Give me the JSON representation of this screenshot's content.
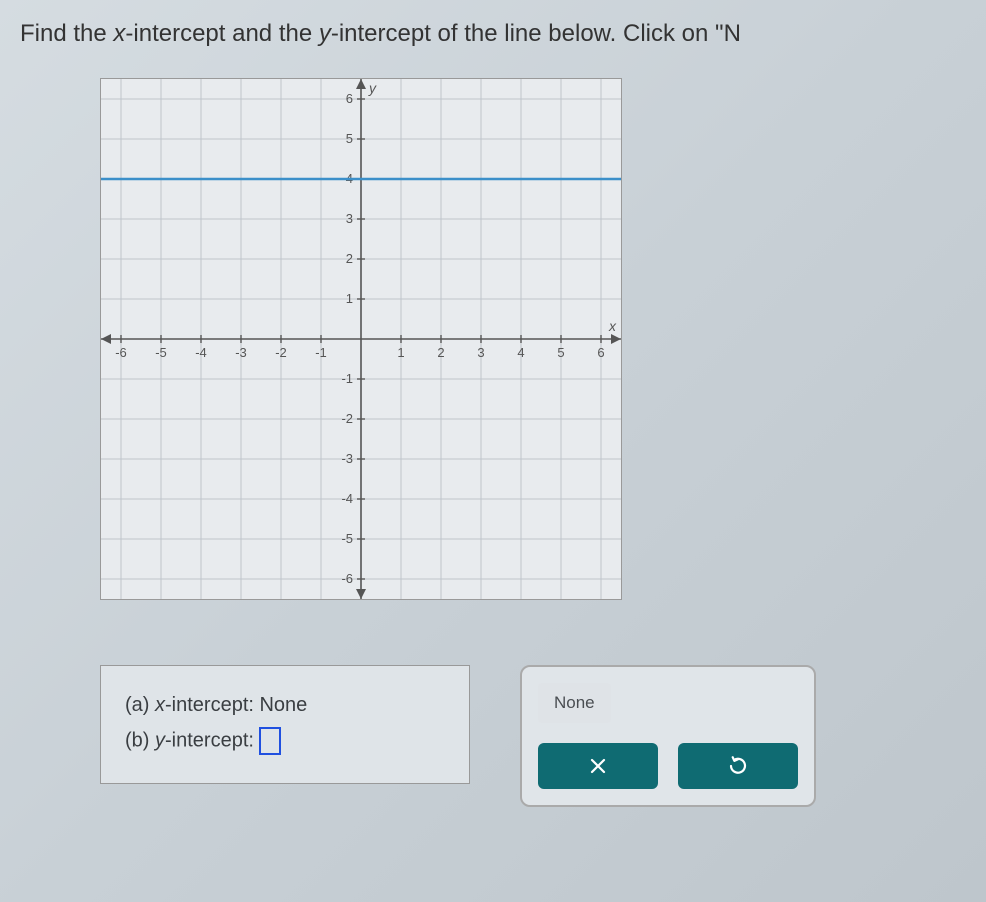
{
  "question": {
    "prefix": "Find the ",
    "x_var": "x",
    "mid1": "-intercept and the ",
    "y_var": "y",
    "mid2": "-intercept of the line below. Click on \"N"
  },
  "answers": {
    "a_prefix": "(a) ",
    "a_var": "x",
    "a_text": "-intercept: ",
    "a_value": "None",
    "b_prefix": "(b) ",
    "b_var": "y",
    "b_text": "-intercept: "
  },
  "tools": {
    "none_label": "None"
  },
  "chart_data": {
    "type": "line",
    "title": "",
    "xlabel": "x",
    "ylabel": "y",
    "xlim": [
      -6.5,
      6.5
    ],
    "ylim": [
      -6.5,
      6.5
    ],
    "x_ticks": [
      -6,
      -5,
      -4,
      -3,
      -2,
      -1,
      1,
      2,
      3,
      4,
      5,
      6
    ],
    "y_ticks": [
      -6,
      -5,
      -4,
      -3,
      -2,
      -1,
      1,
      2,
      3,
      4,
      5,
      6
    ],
    "series": [
      {
        "name": "line",
        "x": [
          -6.5,
          6.5
        ],
        "y": [
          4,
          4
        ],
        "color": "#3b8fc9"
      }
    ]
  }
}
